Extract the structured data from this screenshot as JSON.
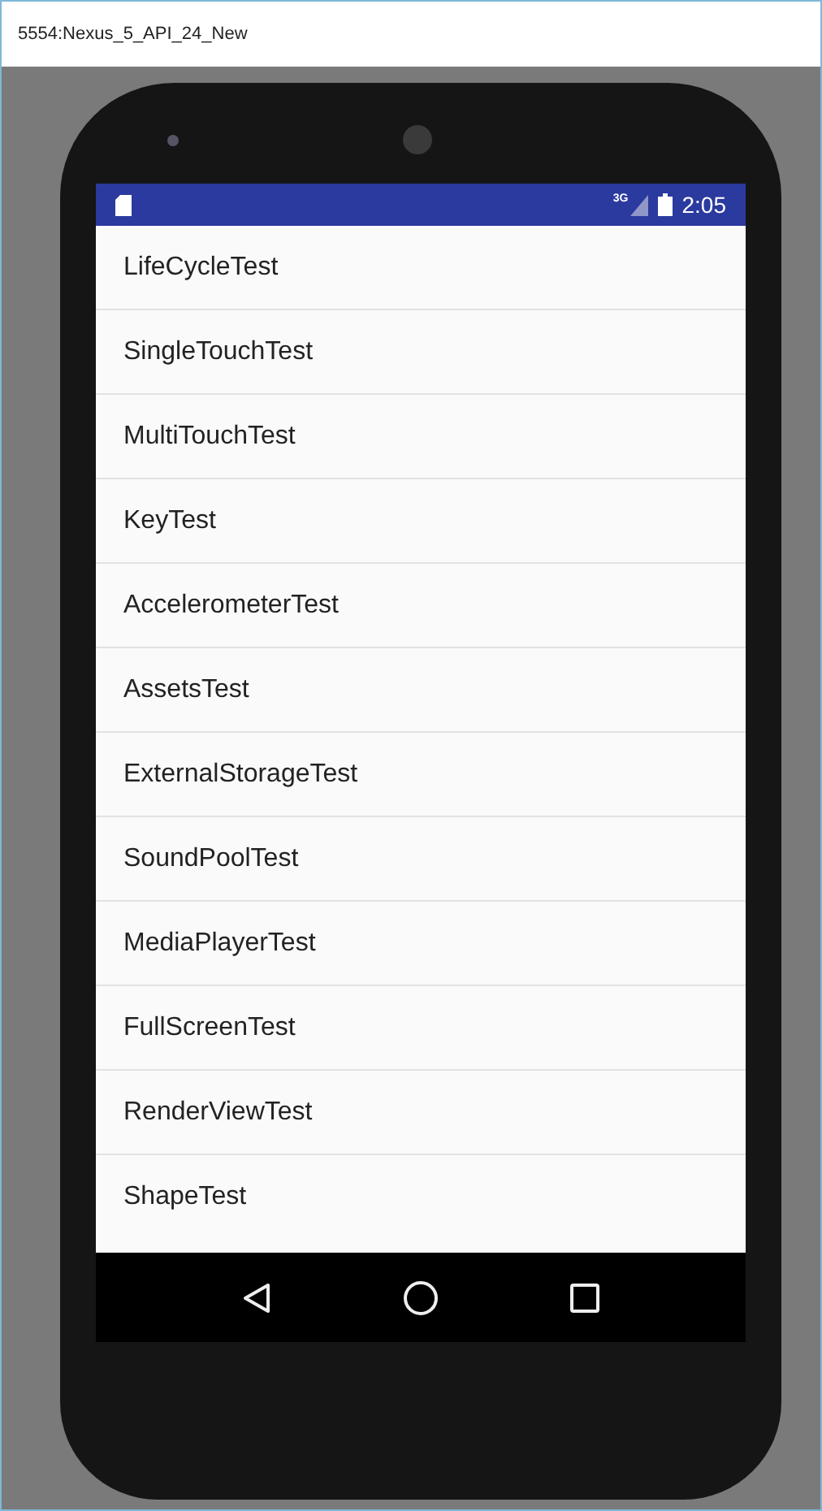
{
  "window": {
    "title": "5554:Nexus_5_API_24_New"
  },
  "status_bar": {
    "network": "3G",
    "time": "2:05"
  },
  "list": [
    {
      "label": "LifeCycleTest"
    },
    {
      "label": "SingleTouchTest"
    },
    {
      "label": "MultiTouchTest"
    },
    {
      "label": "KeyTest"
    },
    {
      "label": "AccelerometerTest"
    },
    {
      "label": "AssetsTest"
    },
    {
      "label": "ExternalStorageTest"
    },
    {
      "label": "SoundPoolTest"
    },
    {
      "label": "MediaPlayerTest"
    },
    {
      "label": "FullScreenTest"
    },
    {
      "label": "RenderViewTest"
    },
    {
      "label": "ShapeTest"
    }
  ]
}
